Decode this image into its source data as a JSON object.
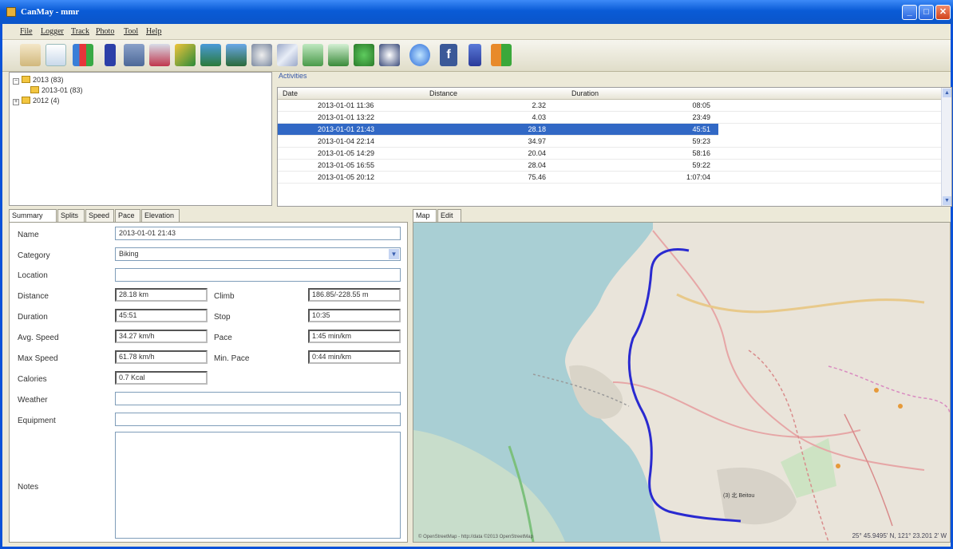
{
  "window": {
    "title": "CanMay - mmr"
  },
  "menu": [
    "File",
    "Logger",
    "Track",
    "Photo",
    "Tool",
    "Help"
  ],
  "toolbar_icons": [
    "route-icon",
    "track-icon",
    "chart-icon",
    "device-icon",
    "truck-icon",
    "report-icon",
    "import-icon",
    "export-icon",
    "export2-icon",
    "gps-icon",
    "merge-icon",
    "split-icon",
    "edit-icon",
    "arrow-green-icon",
    "arrow-flow-icon",
    "globe-icon",
    "facebook-icon",
    "help-icon",
    "exit-icon"
  ],
  "tree": {
    "items": [
      {
        "label": "2013 (83)",
        "expander": "−"
      },
      {
        "label": "2013-01 (83)",
        "expander": ""
      },
      {
        "label": "2012 (4)",
        "expander": "+"
      }
    ]
  },
  "activities": {
    "label": "Activities",
    "columns": [
      "Date",
      "Distance",
      "Duration"
    ],
    "rows": [
      {
        "date": "2013-01-01 11:36",
        "distance": "2.32",
        "duration": "08:05"
      },
      {
        "date": "2013-01-01 13:22",
        "distance": "4.03",
        "duration": "23:49"
      },
      {
        "date": "2013-01-01 21:43",
        "distance": "28.18",
        "duration": "45:51"
      },
      {
        "date": "2013-01-04 22:14",
        "distance": "34.97",
        "duration": "59:23"
      },
      {
        "date": "2013-01-05 14:29",
        "distance": "20.04",
        "duration": "58:16"
      },
      {
        "date": "2013-01-05 16:55",
        "distance": "28.04",
        "duration": "59:22"
      },
      {
        "date": "2013-01-05 20:12",
        "distance": "75.46",
        "duration": "1:07:04"
      }
    ],
    "selected_index": 2
  },
  "left_tabs": [
    "Summary",
    "Splits",
    "Speed",
    "Pace",
    "Elevation"
  ],
  "right_tabs": [
    "Map",
    "Edit"
  ],
  "summary": {
    "name_label": "Name",
    "name_value": "2013-01-01 21:43",
    "category_label": "Category",
    "category_value": "Biking",
    "location_label": "Location",
    "location_value": "",
    "distance_label": "Distance",
    "distance_value": "28.18 km",
    "climb_label": "Climb",
    "climb_value": "186.85/-228.55 m",
    "duration_label": "Duration",
    "duration_value": "45:51",
    "stop_label": "Stop",
    "stop_value": "10:35",
    "avg_speed_label": "Avg. Speed",
    "avg_speed_value": "34.27 km/h",
    "pace_label": "Pace",
    "pace_value": "1:45 min/km",
    "max_speed_label": "Max Speed",
    "max_speed_value": "61.78 km/h",
    "min_pace_label": "Min. Pace",
    "min_pace_value": "0:44 min/km",
    "calories_label": "Calories",
    "calories_value": "0.7 Kcal",
    "weather_label": "Weather",
    "weather_value": "",
    "equipment_label": "Equipment",
    "equipment_value": "",
    "notes_label": "Notes",
    "notes_value": ""
  },
  "map": {
    "attribution": "© OpenStreetMap - http://data ©2013 OpenStreetMap",
    "coords": "25° 45.9495' N, 121° 23.201 2' W",
    "place_label": "(3) 北 Beitou",
    "track_color": "#2a2ad0",
    "water_color": "#a9cfd4"
  }
}
